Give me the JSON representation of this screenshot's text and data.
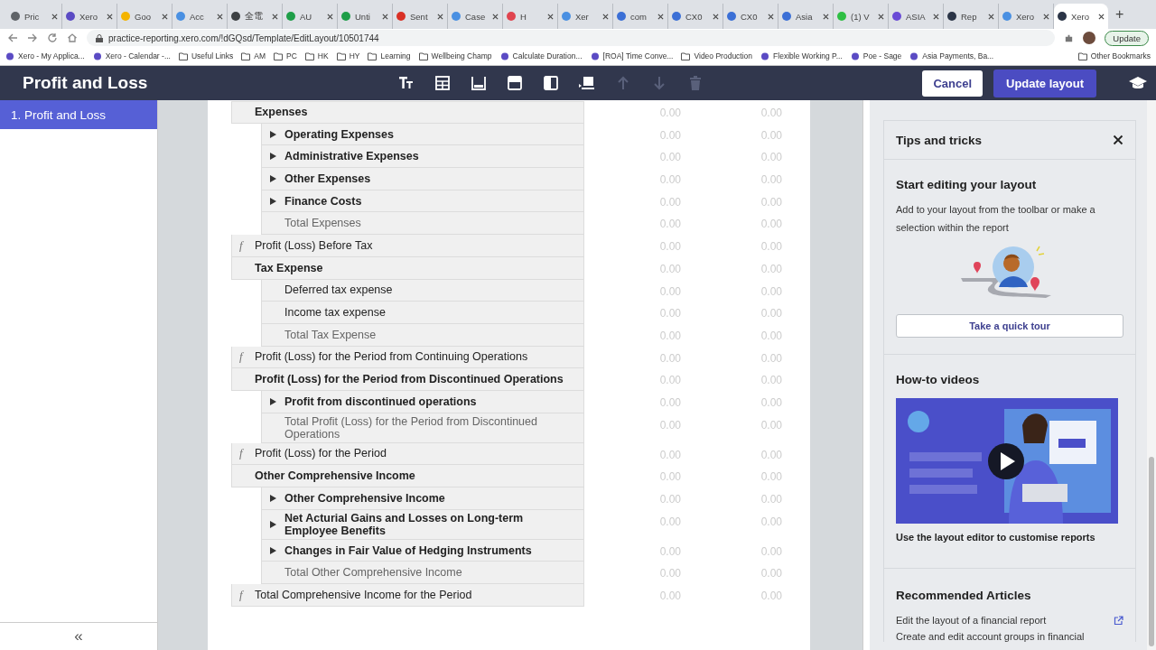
{
  "browser": {
    "tabs": [
      {
        "title": "Pric",
        "color": "#5f6368",
        "selected": false
      },
      {
        "title": "Xero",
        "color": "#5b4bc4",
        "selected": false
      },
      {
        "title": "Goo",
        "color": "#f4b400",
        "selected": false
      },
      {
        "title": "Acc",
        "color": "#4a90e2",
        "selected": false
      },
      {
        "title": "全電",
        "color": "#3c4043",
        "selected": false
      },
      {
        "title": "AU",
        "color": "#1e9e48",
        "selected": false
      },
      {
        "title": "Unti",
        "color": "#1e9e48",
        "selected": false
      },
      {
        "title": "Sent",
        "color": "#d93025",
        "selected": false
      },
      {
        "title": "Case",
        "color": "#4a90e2",
        "selected": false
      },
      {
        "title": "H",
        "color": "#e0444f",
        "selected": false
      },
      {
        "title": "Xer",
        "color": "#4a90e2",
        "selected": false
      },
      {
        "title": "com",
        "color": "#3b6fd6",
        "selected": false
      },
      {
        "title": "CX0",
        "color": "#3b6fd6",
        "selected": false
      },
      {
        "title": "CX0",
        "color": "#3b6fd6",
        "selected": false
      },
      {
        "title": "Asia",
        "color": "#3b6fd6",
        "selected": false
      },
      {
        "title": "(1) V",
        "color": "#2fbf44",
        "selected": false
      },
      {
        "title": "ASIA",
        "color": "#6a4bd6",
        "selected": false
      },
      {
        "title": "Rep",
        "color": "#2b3547",
        "selected": false
      },
      {
        "title": "Xero",
        "color": "#4a90e2",
        "selected": false
      },
      {
        "title": "Xero",
        "color": "#2b3547",
        "selected": true
      }
    ],
    "new_tab": "+",
    "address": "practice-reporting.xero.com/!dGQsd/Template/EditLayout/10501744",
    "update_button": "Update",
    "bookmarks": [
      {
        "label": "Xero - My Applica...",
        "kind": "site"
      },
      {
        "label": "Xero - Calendar -...",
        "kind": "site"
      },
      {
        "label": "Useful Links",
        "kind": "folder"
      },
      {
        "label": "AM",
        "kind": "folder"
      },
      {
        "label": "PC",
        "kind": "folder"
      },
      {
        "label": "HK",
        "kind": "folder"
      },
      {
        "label": "HY",
        "kind": "folder"
      },
      {
        "label": "Learning",
        "kind": "folder"
      },
      {
        "label": "Wellbeing Champ",
        "kind": "folder"
      },
      {
        "label": "Calculate Duration...",
        "kind": "site"
      },
      {
        "label": "[ROA] Time Conve...",
        "kind": "site"
      },
      {
        "label": "Video Production",
        "kind": "folder"
      },
      {
        "label": "Flexible Working P...",
        "kind": "site"
      },
      {
        "label": "Poe - Sage",
        "kind": "site"
      },
      {
        "label": "Asia Payments, Ba...",
        "kind": "site"
      }
    ],
    "other_bookmarks": "Other Bookmarks"
  },
  "header": {
    "title": "Profit and Loss",
    "tools": [
      {
        "kind": "text",
        "disabled": false
      },
      {
        "kind": "table",
        "disabled": false
      },
      {
        "kind": "footer",
        "disabled": false
      },
      {
        "kind": "header",
        "disabled": false
      },
      {
        "kind": "columns",
        "disabled": false
      },
      {
        "kind": "insert",
        "disabled": false
      },
      {
        "kind": "up",
        "disabled": true
      },
      {
        "kind": "down",
        "disabled": true
      },
      {
        "kind": "delete",
        "disabled": true
      }
    ],
    "cancel": "Cancel",
    "update": "Update layout"
  },
  "sidebar": {
    "items": [
      {
        "label": "1. Profit and Loss",
        "selected": true
      }
    ],
    "collapse": "«"
  },
  "report": {
    "rows": [
      {
        "kind": "group",
        "label": "Expenses",
        "values": [
          "0.00",
          "0.00"
        ],
        "children": [
          {
            "kind": "group",
            "label": "Operating Expenses",
            "expanded": false,
            "values": [
              "0.00",
              "0.00"
            ]
          },
          {
            "kind": "group",
            "label": "Administrative Expenses",
            "expanded": false,
            "values": [
              "0.00",
              "0.00"
            ]
          },
          {
            "kind": "group",
            "label": "Other Expenses",
            "expanded": false,
            "values": [
              "0.00",
              "0.00"
            ]
          },
          {
            "kind": "group",
            "label": "Finance Costs",
            "expanded": false,
            "values": [
              "0.00",
              "0.00"
            ]
          },
          {
            "kind": "total",
            "label": "Total Expenses",
            "values": [
              "0.00",
              "0.00"
            ]
          }
        ]
      },
      {
        "kind": "formula",
        "icon": "f",
        "label": "Profit (Loss) Before Tax",
        "values": [
          "0.00",
          "0.00"
        ]
      },
      {
        "kind": "group",
        "label": "Tax Expense",
        "values": [
          "0.00",
          "0.00"
        ],
        "children": [
          {
            "kind": "account",
            "label": "Deferred tax expense",
            "values": [
              "0.00",
              "0.00"
            ]
          },
          {
            "kind": "account",
            "label": "Income tax expense",
            "values": [
              "0.00",
              "0.00"
            ]
          },
          {
            "kind": "total",
            "label": "Total Tax Expense",
            "values": [
              "0.00",
              "0.00"
            ]
          }
        ]
      },
      {
        "kind": "formula",
        "icon": "f",
        "label": "Profit (Loss) for the Period from Continuing Operations",
        "values": [
          "0.00",
          "0.00"
        ]
      },
      {
        "kind": "group",
        "label": "Profit (Loss) for the Period from Discontinued Operations",
        "values": [
          "0.00",
          "0.00"
        ],
        "children": [
          {
            "kind": "group",
            "label": "Profit from discontinued operations",
            "expanded": false,
            "values": [
              "0.00",
              "0.00"
            ]
          },
          {
            "kind": "total",
            "label": "Total Profit (Loss) for the Period from Discontinued Operations",
            "values": [
              "0.00",
              "0.00"
            ]
          }
        ]
      },
      {
        "kind": "formula",
        "icon": "f",
        "label": "Profit (Loss) for the Period",
        "values": [
          "0.00",
          "0.00"
        ]
      },
      {
        "kind": "group",
        "label": "Other Comprehensive Income",
        "values": [
          "0.00",
          "0.00"
        ],
        "children": [
          {
            "kind": "group",
            "label": "Other Comprehensive Income",
            "expanded": false,
            "values": [
              "0.00",
              "0.00"
            ]
          },
          {
            "kind": "group",
            "label": "Net Acturial Gains and Losses on Long-term Employee Benefits",
            "expanded": false,
            "values": [
              "0.00",
              "0.00"
            ]
          },
          {
            "kind": "group",
            "label": "Changes in Fair Value of Hedging Instruments",
            "expanded": false,
            "values": [
              "0.00",
              "0.00"
            ]
          },
          {
            "kind": "total",
            "label": "Total Other Comprehensive Income",
            "values": [
              "0.00",
              "0.00"
            ]
          }
        ]
      },
      {
        "kind": "formula",
        "icon": "f",
        "label": "Total Comprehensive Income for the Period",
        "values": [
          "0.00",
          "0.00"
        ]
      }
    ]
  },
  "tips": {
    "title": "Tips and tricks",
    "start": {
      "heading": "Start editing your layout",
      "text": "Add to your layout from the toolbar or make a selection within the report",
      "button": "Take a quick tour"
    },
    "videos": {
      "heading": "How-to videos",
      "caption": "Use the layout editor to customise reports"
    },
    "articles": {
      "heading": "Recommended Articles",
      "links": [
        "Edit the layout of a financial report",
        "Create and edit account groups in financial"
      ]
    }
  }
}
